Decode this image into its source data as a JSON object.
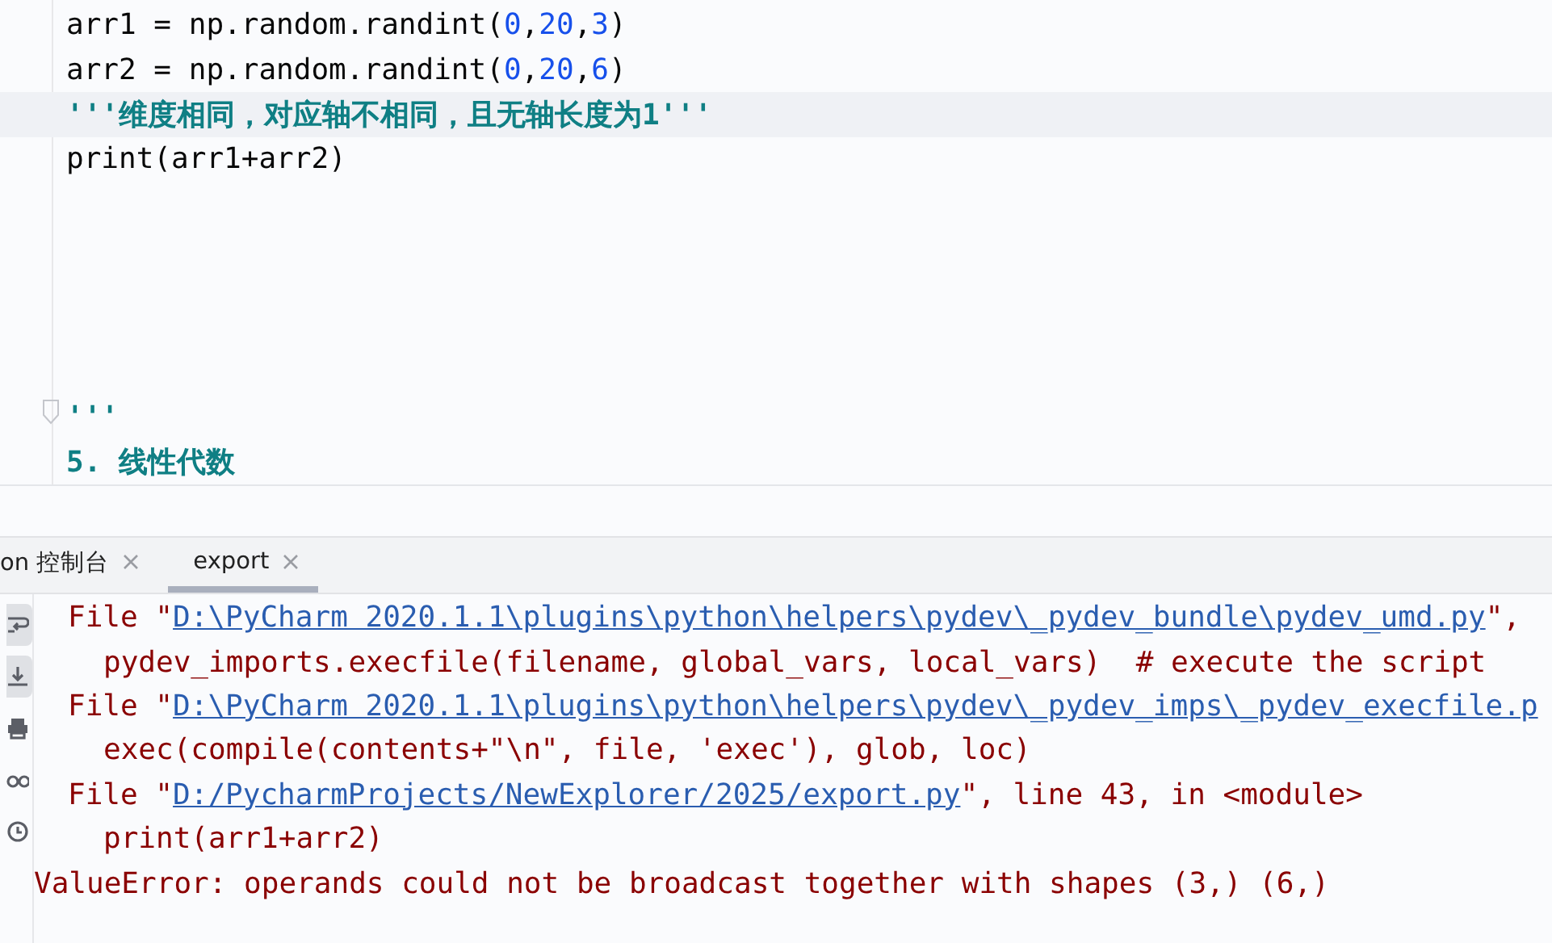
{
  "editor": {
    "blocks": [
      {
        "lines": [
          {
            "current": false,
            "fold": false,
            "tokens": [
              {
                "kind": "plain",
                "text": "arr1 = np.random.randint("
              },
              {
                "kind": "number",
                "text": "0"
              },
              {
                "kind": "plain",
                "text": ","
              },
              {
                "kind": "number",
                "text": "20"
              },
              {
                "kind": "plain",
                "text": ","
              },
              {
                "kind": "number",
                "text": "3"
              },
              {
                "kind": "plain",
                "text": ")"
              }
            ]
          },
          {
            "current": false,
            "fold": false,
            "tokens": [
              {
                "kind": "plain",
                "text": "arr2 = np.random.randint("
              },
              {
                "kind": "number",
                "text": "0"
              },
              {
                "kind": "plain",
                "text": ","
              },
              {
                "kind": "number",
                "text": "20"
              },
              {
                "kind": "plain",
                "text": ","
              },
              {
                "kind": "number",
                "text": "6"
              },
              {
                "kind": "plain",
                "text": ")"
              }
            ]
          },
          {
            "current": true,
            "fold": false,
            "tokens": [
              {
                "kind": "doc",
                "text": "'''维度相同，对应轴不相同，且无轴长度为1'''"
              }
            ]
          },
          {
            "current": false,
            "fold": false,
            "tokens": [
              {
                "kind": "plain",
                "text": "print(arr1+arr2)"
              }
            ]
          }
        ]
      },
      {
        "lines": [
          {
            "current": false,
            "fold": true,
            "tokens": [
              {
                "kind": "doc",
                "text": "'''"
              }
            ]
          },
          {
            "current": false,
            "fold": false,
            "tokens": [
              {
                "kind": "doc",
                "text": "5. 线性代数"
              }
            ]
          }
        ]
      }
    ]
  },
  "console": {
    "tabs": [
      {
        "label": "on 控制台",
        "selected": false
      },
      {
        "label": "export",
        "selected": true
      }
    ],
    "toolbar": [
      {
        "kind": "wrap",
        "on": true
      },
      {
        "kind": "scroll",
        "on": true
      },
      {
        "kind": "print",
        "on": false
      },
      {
        "kind": "glasses",
        "on": false
      },
      {
        "kind": "history",
        "on": false
      }
    ],
    "lines": [
      {
        "kind": "frame",
        "segments": [
          {
            "kind": "text",
            "text": "File \""
          },
          {
            "kind": "link",
            "text": "D:\\PyCharm 2020.1.1\\plugins\\python\\helpers\\pydev\\_pydev_bundle\\pydev_umd.py"
          },
          {
            "kind": "text",
            "text": "\","
          }
        ]
      },
      {
        "kind": "source",
        "segments": [
          {
            "kind": "text",
            "text": "pydev_imports.execfile(filename, global_vars, local_vars)  # execute the script"
          }
        ]
      },
      {
        "kind": "frame",
        "segments": [
          {
            "kind": "text",
            "text": "File \""
          },
          {
            "kind": "link",
            "text": "D:\\PyCharm 2020.1.1\\plugins\\python\\helpers\\pydev\\_pydev_imps\\_pydev_execfile.p"
          }
        ]
      },
      {
        "kind": "source",
        "segments": [
          {
            "kind": "text",
            "text": "exec(compile(contents+\"\\n\", file, 'exec'), glob, loc)"
          }
        ]
      },
      {
        "kind": "frame",
        "segments": [
          {
            "kind": "text",
            "text": "File \""
          },
          {
            "kind": "link",
            "text": "D:/PycharmProjects/NewExplorer/2025/export.py"
          },
          {
            "kind": "text",
            "text": "\", line 43, in <module>"
          }
        ]
      },
      {
        "kind": "source",
        "segments": [
          {
            "kind": "text",
            "text": "print(arr1+arr2)"
          }
        ]
      },
      {
        "kind": "error",
        "segments": [
          {
            "kind": "text",
            "text": "ValueError: operands could not be broadcast together with shapes (3,) (6,)"
          }
        ]
      }
    ]
  }
}
